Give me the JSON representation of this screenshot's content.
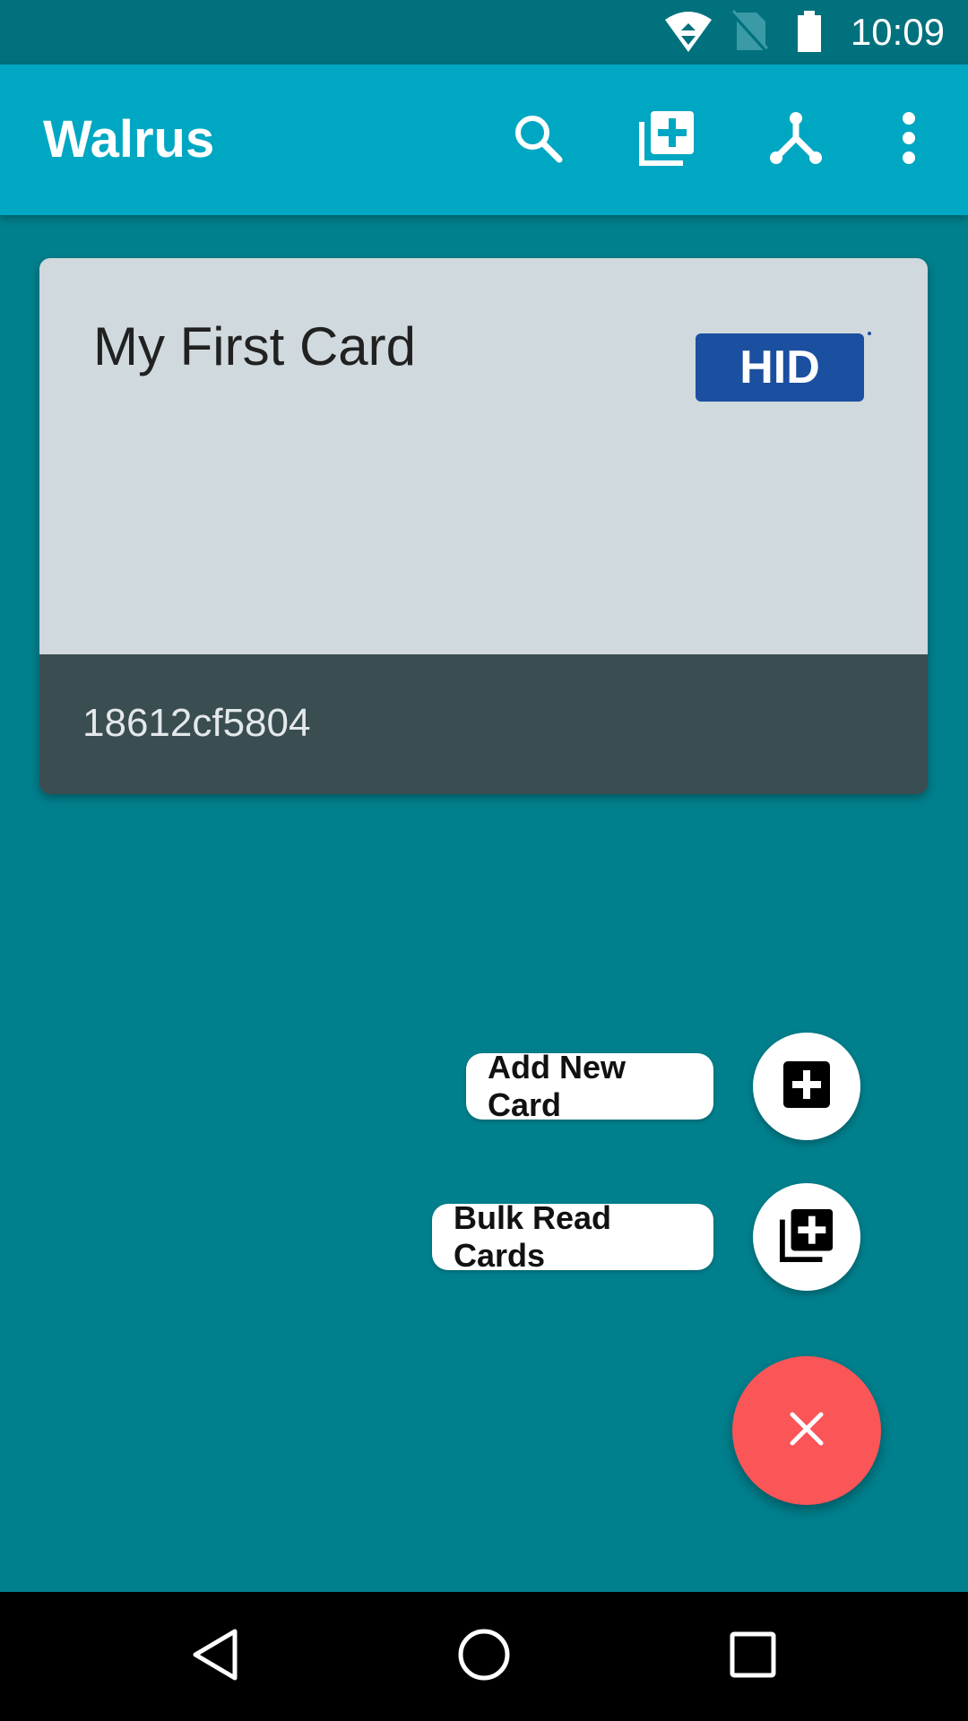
{
  "status_bar": {
    "time": "10:09",
    "icons": [
      "wifi-icon",
      "no-sim-icon",
      "battery-icon"
    ]
  },
  "app_bar": {
    "title": "Walrus",
    "actions": [
      "search-icon",
      "add-to-photos-icon",
      "merge-type-icon",
      "more-vert-icon"
    ]
  },
  "card": {
    "title": "My First Card",
    "logo_text": "HID",
    "id": "18612cf5804",
    "colors": {
      "top": "#d0d9de",
      "bottom": "#3a4d51",
      "logo": "#1b4fa0"
    }
  },
  "fab_menu": {
    "items": [
      {
        "label": "Add New Card",
        "icon": "add-box-icon"
      },
      {
        "label": "Bulk Read Cards",
        "icon": "add-to-photos-icon"
      }
    ],
    "close_icon": "close-icon",
    "fab_color": "#fa5557"
  },
  "nav_bar": {
    "buttons": [
      "back-icon",
      "home-icon",
      "recents-icon"
    ]
  }
}
